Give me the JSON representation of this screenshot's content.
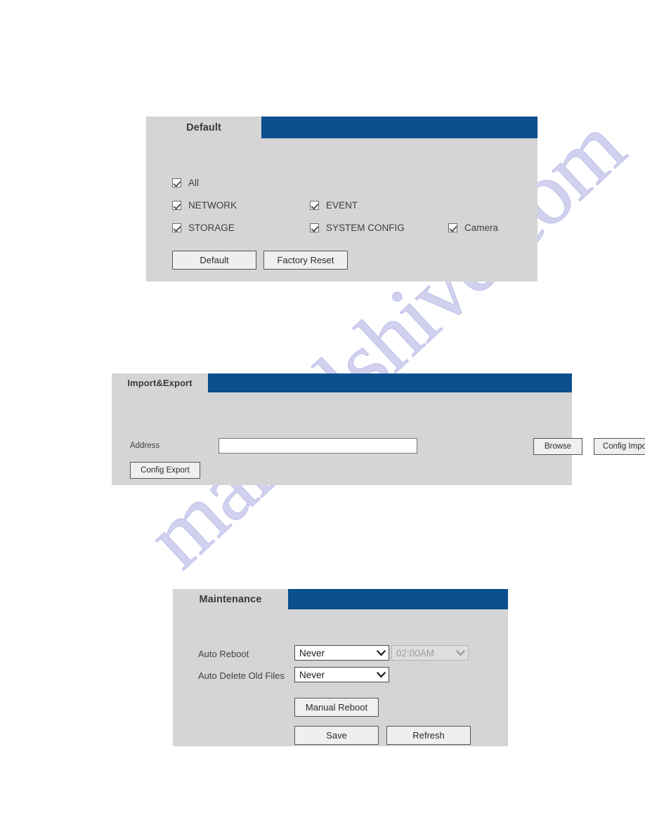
{
  "page": {
    "background": "#ffffff",
    "watermark": "manualshive.com"
  },
  "colors": {
    "header_blue": "#0b4f8f",
    "panel_gray": "#d5d5d5",
    "button_face": "#efefef",
    "disabled_gray": "#dedede"
  },
  "default_panel": {
    "tab_title": "Default",
    "checkboxes": [
      {
        "label": "All",
        "checked": true
      },
      {
        "label": "NETWORK",
        "checked": true
      },
      {
        "label": "EVENT",
        "checked": true
      },
      {
        "label": "STORAGE",
        "checked": true
      },
      {
        "label": "SYSTEM CONFIG",
        "checked": true
      },
      {
        "label": "Camera",
        "checked": true
      }
    ],
    "buttons": {
      "default": "Default",
      "factory_reset": "Factory Reset"
    }
  },
  "import_export_panel": {
    "tab_title": "Import&Export",
    "address_label": "Address",
    "address_value": "",
    "address_placeholder": "",
    "buttons": {
      "browse": "Browse",
      "config_import": "Config Import",
      "config_export": "Config Export"
    }
  },
  "maintenance_panel": {
    "tab_title": "Maintenance",
    "auto_reboot_label": "Auto Reboot",
    "auto_reboot_value": "Never",
    "auto_reboot_time_value": "02:00AM",
    "auto_delete_label": "Auto Delete Old Files",
    "auto_delete_value": "Never",
    "buttons": {
      "manual_reboot": "Manual Reboot",
      "save": "Save",
      "refresh": "Refresh"
    }
  }
}
